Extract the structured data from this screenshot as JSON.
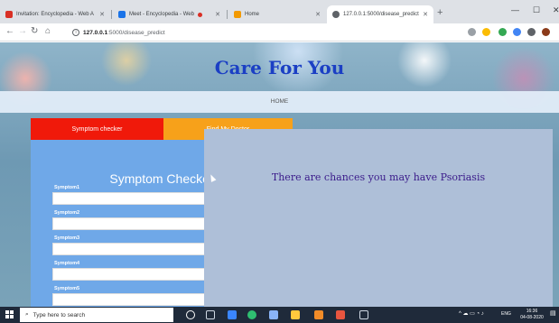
{
  "browser": {
    "tabs": [
      {
        "title": "Invitation: Encyclopedia - Web A",
        "color": "#d93025"
      },
      {
        "title": "Meet - Encyclopedia - Web",
        "color": "#1a73e8"
      },
      {
        "title": "Home",
        "color": "#f29900"
      },
      {
        "title": "127.0.0.1:5000/disease_predict",
        "color": "#5f6368"
      }
    ],
    "url_host": "127.0.0.1",
    "url_path": ":5000/disease_predict"
  },
  "page": {
    "site_title": "Care For You",
    "nav_home": "HOME",
    "tab_symptom_checker": "Symptom checker",
    "tab_find_doctor": "Find My Doctor",
    "form_heading": "Symptom Checker",
    "fields": [
      {
        "label": "Symptom1"
      },
      {
        "label": "Symptom2"
      },
      {
        "label": "Symptom3"
      },
      {
        "label": "Symptom4"
      },
      {
        "label": "Symptom5"
      }
    ],
    "result_message": "There are chances you may have Psoriasis"
  },
  "taskbar": {
    "search_placeholder": "Type here to search",
    "lang": "ENG",
    "time": "16:36",
    "date": "04-08-2020"
  },
  "colors": {
    "title_blue": "#1b3fc4",
    "symptom_tab_red": "#f0190a",
    "doctor_tab_orange": "#f7a11a",
    "form_blue": "#6fa8e8",
    "modal_bg": "#aebfd8",
    "result_text": "#3a1a8a"
  }
}
